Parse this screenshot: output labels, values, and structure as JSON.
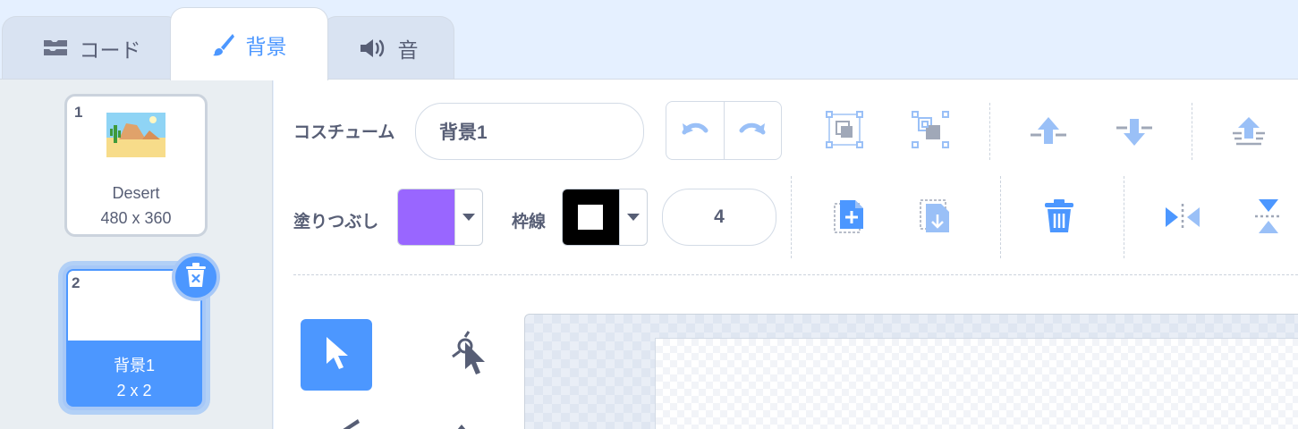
{
  "tabs": [
    {
      "label": "コード",
      "icon": "code-blocks-icon",
      "active": false
    },
    {
      "label": "背景",
      "icon": "paintbrush-icon",
      "active": true
    },
    {
      "label": "音",
      "icon": "speaker-icon",
      "active": false
    }
  ],
  "backdrops": [
    {
      "number": "1",
      "name": "Desert",
      "size": "480 x 360",
      "selected": false
    },
    {
      "number": "2",
      "name": "背景1",
      "size": "2 x 2",
      "selected": true
    }
  ],
  "editor": {
    "costume_label": "コスチューム",
    "costume_name": "背景1",
    "fill_label": "塗りつぶし",
    "fill_color": "#9966ff",
    "outline_label": "枠線",
    "outline_color": "#000000",
    "outline_width": "4"
  },
  "toolbar_icons": {
    "undo": "undo-icon",
    "redo": "redo-icon",
    "group": "group-icon",
    "ungroup": "ungroup-icon",
    "forward": "forward-icon",
    "backward": "backward-icon",
    "front": "front-icon",
    "paste": "paste-icon",
    "copy": "copy-icon",
    "delete": "trash-icon",
    "flip_h": "flip-horizontal-icon",
    "flip_v": "flip-vertical-icon"
  },
  "colors": {
    "accent": "#4c97ff",
    "text": "#575e75",
    "purple_fill": "#9966ff"
  }
}
